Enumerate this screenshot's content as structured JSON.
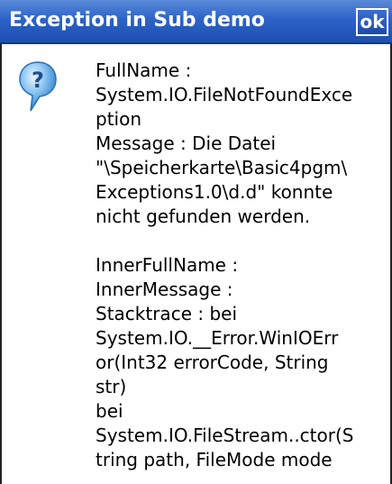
{
  "window": {
    "title": "Exception in Sub demo",
    "ok_label": "ok"
  },
  "dialog": {
    "icon": "question-bubble-icon",
    "message": "FullName :\nSystem.IO.FileNotFoundExce\nption\nMessage : Die Datei\n\"\\Speicherkarte\\Basic4pgm\\\nExceptions1.0\\d.d\" konnte\nnicht gefunden werden.\n\nInnerFullName :\nInnerMessage :\nStacktrace : bei\nSystem.IO.__Error.WinIOErr\nor(Int32 errorCode, String\nstr)\nbei\nSystem.IO.FileStream..ctor(S\ntring path, FileMode mode"
  },
  "colors": {
    "titlebar": "#2d63c8",
    "title_text": "#ffffff",
    "background": "#ffffff"
  }
}
